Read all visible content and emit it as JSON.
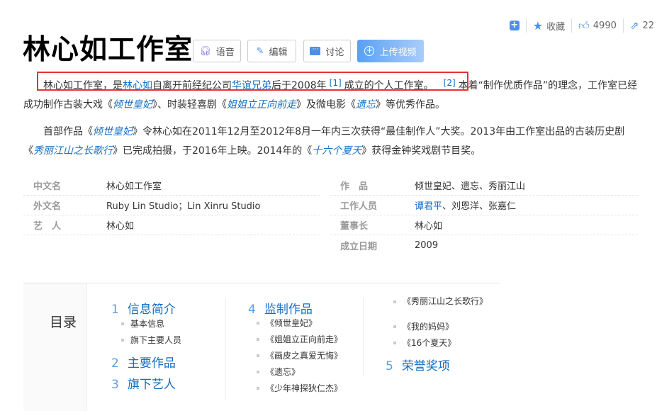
{
  "toolbar": {
    "add_label": "+",
    "favorite_label": "收藏",
    "like_count": "4990",
    "share_count": "22"
  },
  "title": "林心如工作室",
  "buttons": {
    "voice": "语音",
    "edit": "编辑",
    "discuss": "讨论",
    "upload_video": "上传视频"
  },
  "intro": {
    "p1": {
      "t1": "林心如工作室，是",
      "l1": "林心如",
      "t2": "自离开前经纪公司",
      "l2": "华谊兄弟",
      "t3": "后于2008年",
      "ref1": "[1]",
      "t4": "成立的个人工作室。",
      "ref2": "[2]",
      "t5": "本着“制作优质作品”的理念，工作室已经成功制作古装大戏《",
      "l3": "倾世皇妃",
      "t6": "》、时装轻喜剧《",
      "l4": "姐姐立正向前走",
      "t7": "》及微电影《",
      "l5": "遗忘",
      "t8": "》等优秀作品。"
    },
    "p2": {
      "t1": "首部作品《",
      "l1": "倾世皇妃",
      "t2": "》令林心如在2011年12月至2012年8月一年内三次获得“最佳制作人”大奖。2013年由工作室出品的古装历史剧《",
      "l2": "秀丽江山之长歌行",
      "t3": "》已完成拍摄，于2016年上映。2014年的《",
      "l3": "十六个夏天",
      "t4": "》获得金钟奖戏剧节目奖。"
    }
  },
  "infobox": {
    "left": [
      {
        "label": "中文名",
        "value": "林心如工作室"
      },
      {
        "label": "外文名",
        "value": "Ruby Lin Studio；Lin Xinru Studio"
      },
      {
        "label": "艺　人",
        "value": "林心如"
      }
    ],
    "right": [
      {
        "label": "作　品",
        "value": "倾世皇妃、遗忘、秀丽江山"
      },
      {
        "label": "工作人员",
        "link": "谭君平",
        "value": "、刘恩洋、张嘉仁"
      },
      {
        "label": "董事长",
        "value": "林心如"
      },
      {
        "label": "成立日期",
        "value": "2009"
      }
    ]
  },
  "catalog": {
    "title": "目录",
    "s1": {
      "num": "1",
      "label": "信息简介",
      "subs": [
        "基本信息",
        "旗下主要人员"
      ]
    },
    "s2": {
      "num": "2",
      "label": "主要作品"
    },
    "s3": {
      "num": "3",
      "label": "旗下艺人"
    },
    "s4": {
      "num": "4",
      "label": "监制作品",
      "subs": [
        "《倾世皇妃》",
        "《姐姐立正向前走》",
        "《画皮之真爱无悔》",
        "《遗忘》",
        "《少年神探狄仁杰》",
        "《秀丽江山之长歌行》",
        "《我的妈妈》",
        "《16个夏天》"
      ]
    },
    "s5": {
      "num": "5",
      "label": "荣誉奖项"
    }
  }
}
